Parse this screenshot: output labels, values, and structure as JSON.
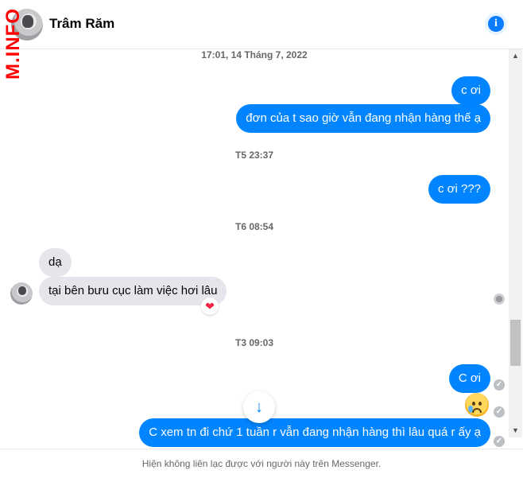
{
  "header": {
    "watermark": "M.INFO",
    "contact_name": "Trâm Răm",
    "info_icon": "info-icon",
    "info_glyph": "i"
  },
  "thread": {
    "timestamps": [
      "17:01, 14 Tháng 7, 2022",
      "T5 23:37",
      "T6 08:54",
      "T3 09:03"
    ],
    "messages": [
      {
        "direction": "out",
        "text": "c ơi"
      },
      {
        "direction": "out",
        "text": "đơn của t sao giờ vẫn đang nhận hàng thế ạ"
      },
      {
        "direction": "out",
        "text": "c ơi ???"
      },
      {
        "direction": "in",
        "text": "dạ"
      },
      {
        "direction": "in",
        "text": "tại bên bưu cục làm việc hơi lâu",
        "reaction": "❤"
      },
      {
        "direction": "out",
        "text": "C ơi"
      },
      {
        "direction": "out",
        "emoji": "sad-tear-emoji"
      },
      {
        "direction": "out",
        "text": "C xem tn đi chứ 1 tuần r vẫn đang nhận hàng thì lâu quá r ấy ạ"
      }
    ],
    "scroll_down_glyph": "↓",
    "check_glyph": "✓"
  },
  "scrollbar": {
    "up_glyph": "▲",
    "down_glyph": "▼"
  },
  "footer": {
    "notice": "Hiện không liên lạc được với người này trên Messenger."
  },
  "colors": {
    "accent": "#0084ff",
    "incoming_bubble": "#e4e6eb",
    "watermark": "#ff0000"
  }
}
